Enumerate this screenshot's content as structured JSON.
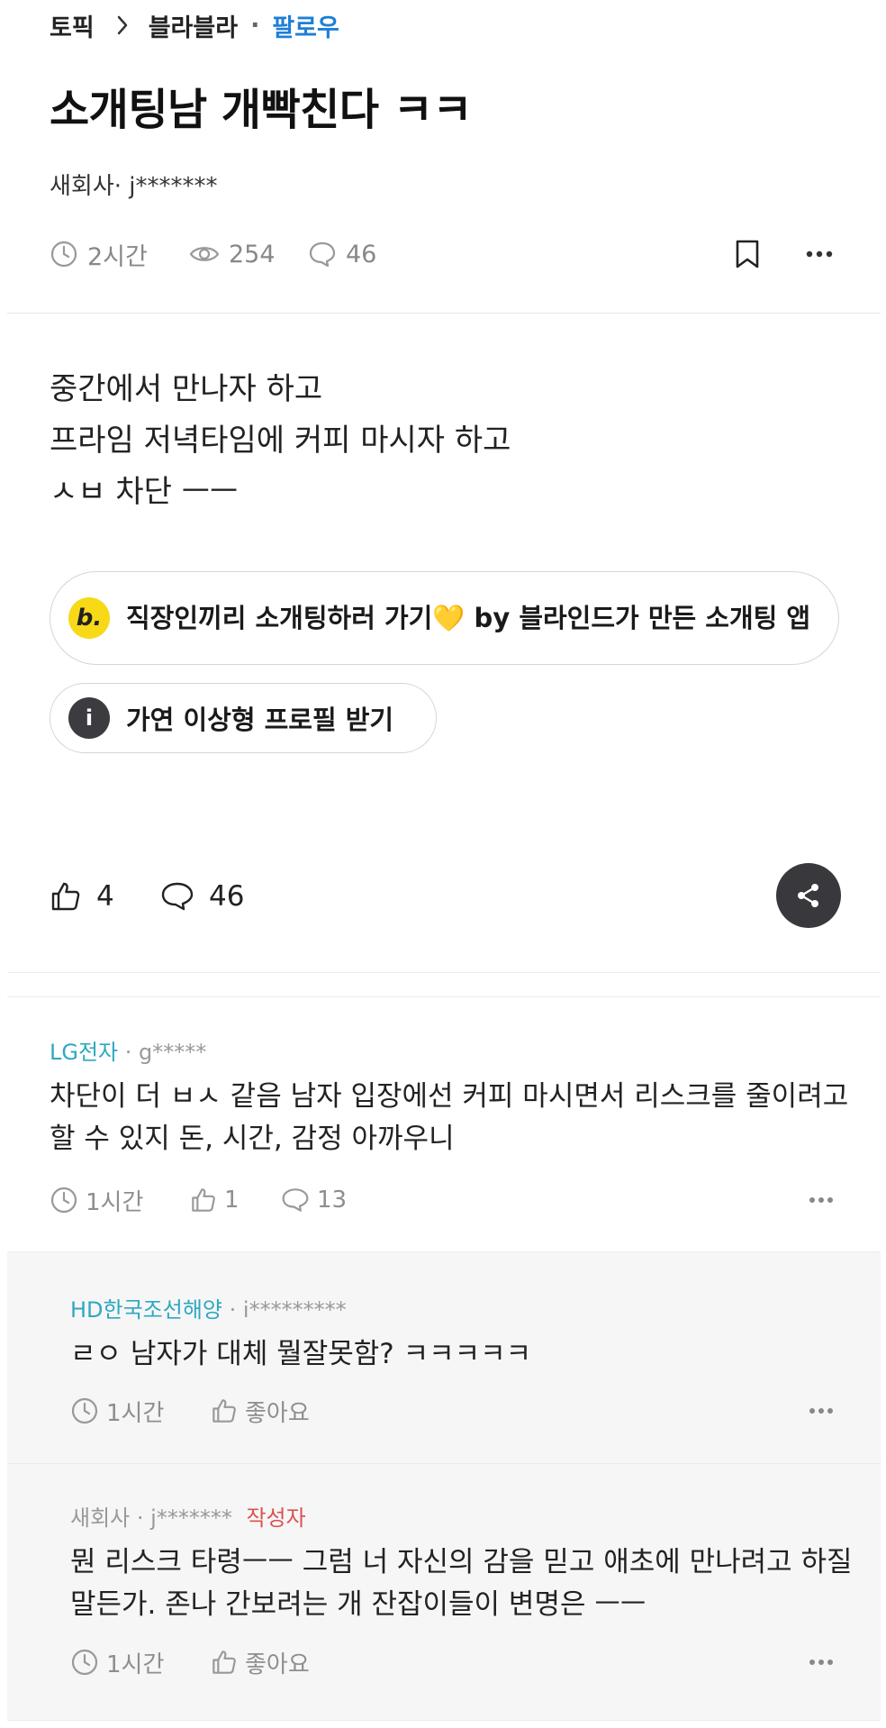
{
  "breadcrumb": {
    "topic": "토픽",
    "board": "블라블라",
    "separator": "·",
    "follow": "팔로우"
  },
  "post": {
    "title": "소개팅남 개빡친다 ㅋㅋ",
    "author": "새회사· j*******",
    "time": "2시간",
    "views": "254",
    "comments": "46",
    "body_lines": [
      "중간에서 만나자 하고",
      "프라임 저녁타임에 커피 마시자 하고",
      "ㅅㅂ 차단 ㅡㅡ"
    ]
  },
  "promo": {
    "badge": "b.",
    "text": "직장인끼리 소개팅하러 가기💛 by 블라인드가 만든 소개팅 앱"
  },
  "info": {
    "badge": "i",
    "text": "가연 이상형 프로필 받기"
  },
  "actions": {
    "likes": "4",
    "comments": "46"
  },
  "comments": [
    {
      "company": "LG전자",
      "user": "· g*****",
      "text": "차단이 더 ㅂㅅ 같음 남자 입장에선 커피 마시면서 리스크를 줄이려고 할 수 있지 돈, 시간, 감정 아까우니",
      "time": "1시간",
      "likes": "1",
      "replies": "13"
    }
  ],
  "replies": [
    {
      "company": "HD한국조선해양",
      "user": "· i*********",
      "text": "ㄹㅇ 남자가 대체 뭘잘못함? ㅋㅋㅋㅋㅋ",
      "time": "1시간",
      "like_label": "좋아요"
    },
    {
      "company": "새회사",
      "user": "· j*******",
      "op_badge": "작성자",
      "text": "뭔 리스크 타령ㅡㅡ 그럼 너 자신의 감을 믿고 애초에 만나려고 하질 말든가. 존나 간보려는 개 잔잡이들이 변명은 ㅡㅡ",
      "time": "1시간",
      "like_label": "좋아요"
    }
  ],
  "colors": {
    "follow": "#1e7fd6",
    "company": "#2ea8c0",
    "op": "#d9534f",
    "promo_badge": "#f7d917",
    "share": "#38383d"
  }
}
